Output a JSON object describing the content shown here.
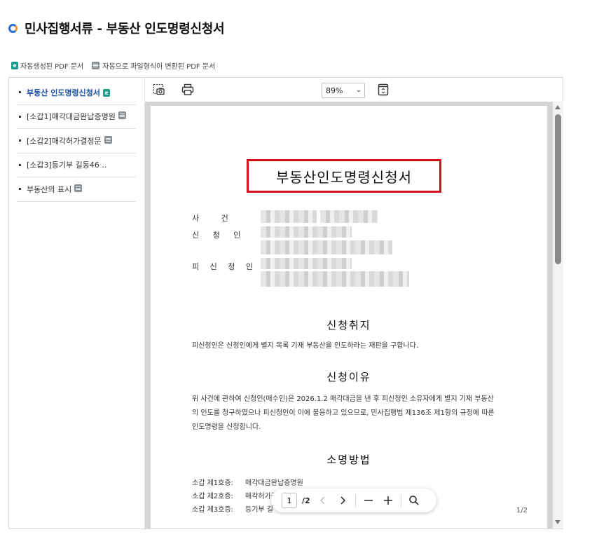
{
  "page": {
    "title": "민사집행서류 - 부동산 인도명령신청서"
  },
  "legend": {
    "auto_badge": "e",
    "auto_label": "자동생성된 PDF 문서",
    "converted_label": "자동으로 파일형식이 변환된 PDF 문서"
  },
  "sidebar": {
    "items": [
      {
        "label": "부동산 인도명령신청서",
        "badge": "auto",
        "active": true
      },
      {
        "label": "[소갑1]매각대금완납증명원",
        "badge": "converted",
        "active": false
      },
      {
        "label": "[소갑2]매각허가결정문",
        "badge": "converted",
        "active": false
      },
      {
        "label": "[소갑3]등기부 길동46 ..",
        "badge": "",
        "active": false
      },
      {
        "label": "부동산의 표시",
        "badge": "converted",
        "active": false
      }
    ]
  },
  "toolbar": {
    "zoom_value": "89%",
    "zoom_options": [
      "89%"
    ]
  },
  "document": {
    "title": "부동산인도명령신청서",
    "fields": {
      "case_label": "사 건",
      "applicant_label": "신 청 인",
      "respondent_label": "피 신 청 인"
    },
    "sections": {
      "purpose_heading": "신청취지",
      "purpose_text": "피신청인은 신청인에게 별지 목록 기재 부동산을 인도하라는 재판을 구합니다.",
      "reason_heading": "신청이유",
      "reason_text": "위 사건에 관하여 신청인(매수인)은 2026.1.2 매각대금을 낸 후 피신청인 소유자에게 별지 기재 부동산의 인도를 청구하였으나 피신청인이 이에 불응하고 있으므로, 민사집행법 제136조 제1항의 규정에 따른 인도명령을 신청합니다.",
      "evidence_heading": "소명방법",
      "evidence": [
        {
          "key": "소갑 제1호증:",
          "value": "매각대금완납증명원"
        },
        {
          "key": "소갑 제2호증:",
          "value": "매각허가결"
        },
        {
          "key": "소갑 제3호증:",
          "value": "등기부 길"
        }
      ]
    },
    "page_indicator": "1/2"
  },
  "pager": {
    "current": "1",
    "total": "/2"
  },
  "colors": {
    "accent": "#1a4fa3",
    "title_box": "#d0101b",
    "auto_badge": "#1a9a8a",
    "converted_badge": "#8a8f96"
  }
}
